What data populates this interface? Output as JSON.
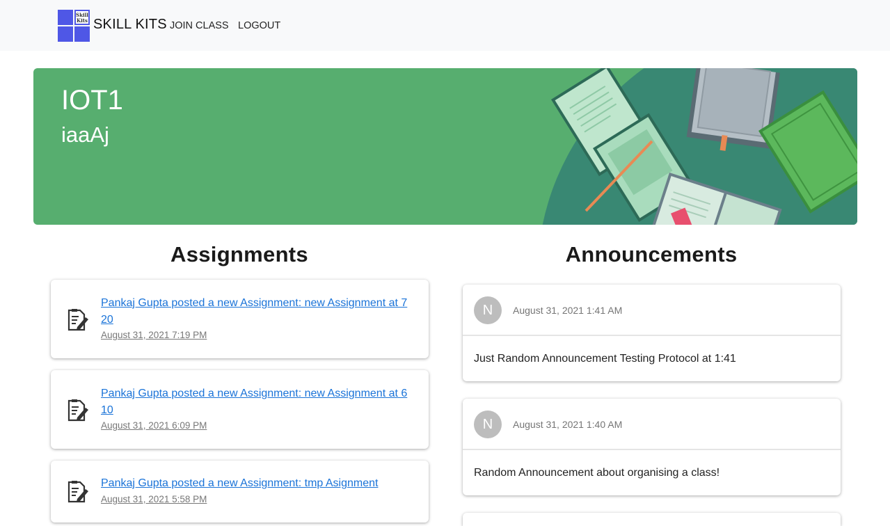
{
  "navbar": {
    "logo_text": "Skill Kits",
    "brand": "SKILL KITS",
    "links": [
      "JOIN CLASS",
      "LOGOUT"
    ]
  },
  "banner": {
    "title": "IOT1",
    "subtitle": "iaaAj"
  },
  "assignments": {
    "heading": "Assignments",
    "items": [
      {
        "text": "Pankaj Gupta posted a new Assignment: new Assignment at 7 20",
        "date": "August 31, 2021 7:19 PM",
        "icon": "assignment-icon"
      },
      {
        "text": "Pankaj Gupta posted a new Assignment: new Assignment at 6 10",
        "date": "August 31, 2021 6:09 PM",
        "icon": "assignment-icon"
      },
      {
        "text": "Pankaj Gupta posted a new Assignment: tmp Asignment",
        "date": "August 31, 2021 5:58 PM",
        "icon": "assignment-icon"
      }
    ]
  },
  "announcements": {
    "heading": "Announcements",
    "items": [
      {
        "avatar": "N",
        "date": "August 31, 2021 1:41 AM",
        "body": "Just Random Announcement Testing Protocol at 1:41"
      },
      {
        "avatar": "N",
        "date": "August 31, 2021 1:40 AM",
        "body": "Random Announcement about organising a class!"
      }
    ]
  },
  "colors": {
    "banner": "#57ae6f",
    "link": "#1a73d8",
    "logo": "#4f57e6"
  }
}
